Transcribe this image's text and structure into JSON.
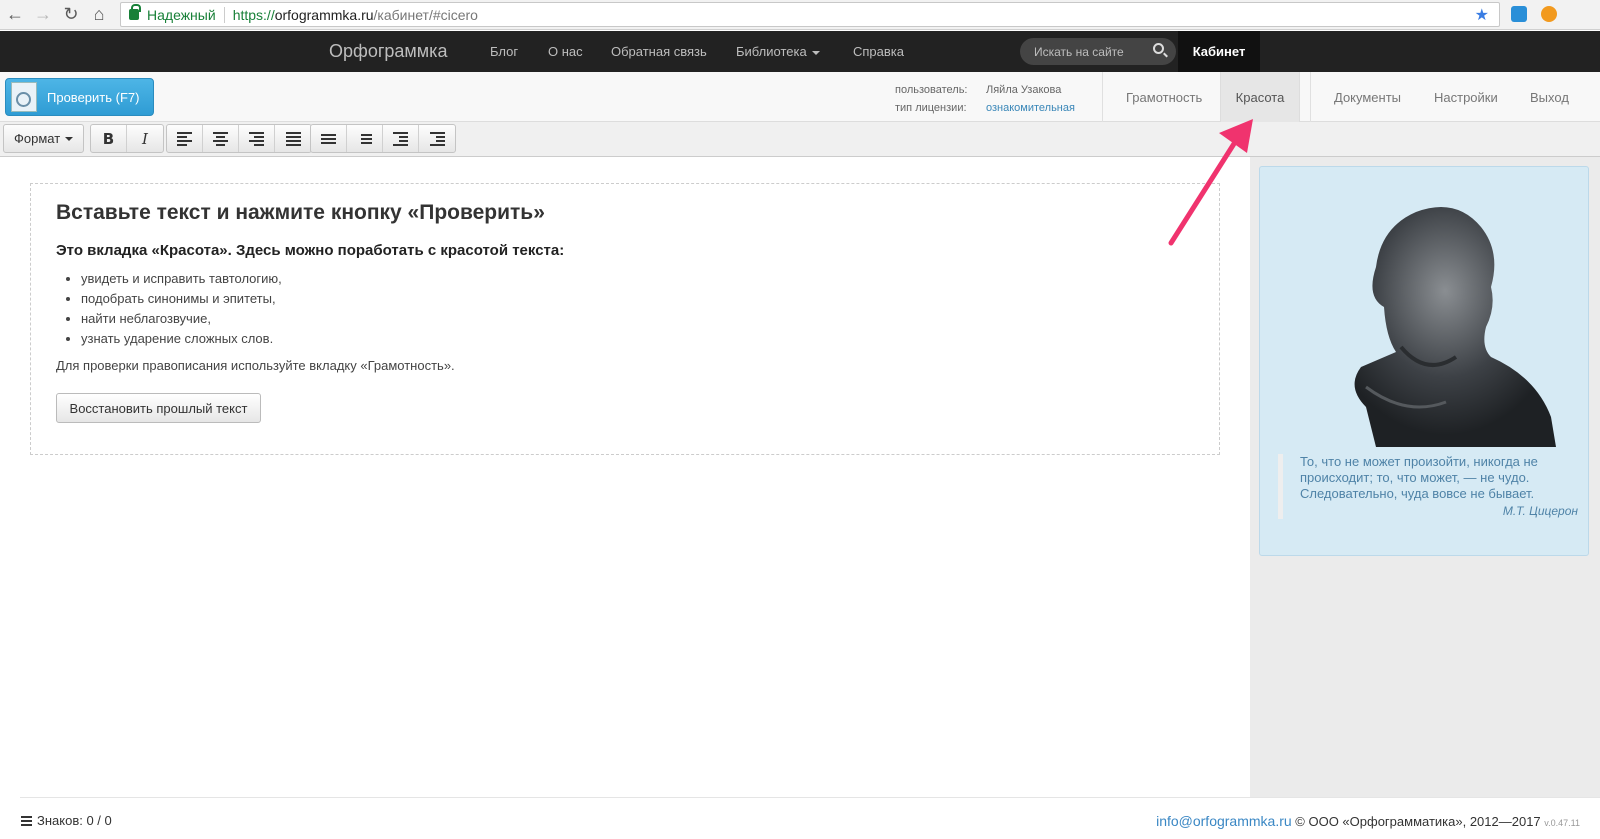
{
  "browser": {
    "secure_label": "Надежный",
    "url_scheme": "https://",
    "url_host": "orfogrammka.ru",
    "url_path": "/кабинет/#cicero"
  },
  "navbar": {
    "brand": "Орфограммка",
    "links": [
      "Блог",
      "О нас",
      "Обратная связь",
      "Библиотека",
      "Справка"
    ],
    "search_placeholder": "Искать на сайте",
    "cabinet": "Кабинет"
  },
  "subbar": {
    "check_button": "Проверить (F7)",
    "user_label": "пользователь:",
    "user_name": "Ляйла Узакова",
    "license_label": "тип лицензии:",
    "license_value": "ознакомительная",
    "tabs": [
      "Грамотность",
      "Красота",
      "Документы",
      "Настройки",
      "Выход"
    ],
    "active_tab": "Красота"
  },
  "toolbar": {
    "format_label": "Формат",
    "bold": "B",
    "italic": "I"
  },
  "editor": {
    "title": "Вставьте текст и нажмите кнопку «Проверить»",
    "subtitle": "Это вкладка «Красота». Здесь можно поработать с красотой текста:",
    "items": [
      "увидеть и исправить тавтологию,",
      "подобрать синонимы и эпитеты,",
      "найти неблагозвучие,",
      "узнать ударение сложных слов."
    ],
    "note": "Для проверки правописания используйте вкладку «Грамотность».",
    "restore_button": "Восстановить прошлый текст"
  },
  "sidebar": {
    "quote": "То, что не может произойти, никогда не происходит; то, что может, — не чудо. Следовательно, чуда вовсе не бывает.",
    "author": "М.Т. Цицерон"
  },
  "footer": {
    "counter": "Знаков: 0 / 0",
    "email": "info@orfogrammka.ru",
    "copyright": "© ООО «Орфограмматика», 2012—2017",
    "version": "v.0.47.11"
  },
  "colors": {
    "accent": "#2f9cd4",
    "navbar": "#222222",
    "arrow": "#f0336e",
    "quote_bg": "#d6eaf4"
  }
}
